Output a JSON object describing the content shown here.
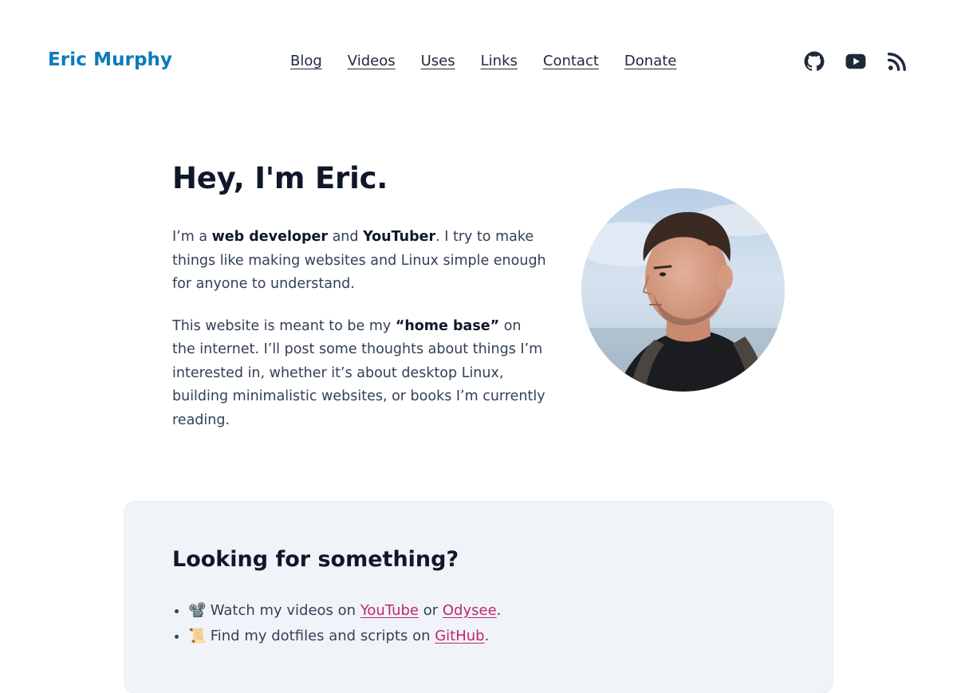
{
  "header": {
    "brand": "Eric Murphy",
    "nav": [
      {
        "label": "Blog"
      },
      {
        "label": "Videos"
      },
      {
        "label": "Uses"
      },
      {
        "label": "Links"
      },
      {
        "label": "Contact"
      },
      {
        "label": "Donate"
      }
    ],
    "social": [
      {
        "icon": "github-icon"
      },
      {
        "icon": "youtube-icon"
      },
      {
        "icon": "rss-icon"
      }
    ]
  },
  "hero": {
    "title": "Hey, I'm Eric.",
    "p1": {
      "t1": "I’m a ",
      "b1": "web developer",
      "t2": " and ",
      "b2": "YouTuber",
      "t3": ". I try to make things like making websites and Linux simple enough for anyone to understand."
    },
    "p2": {
      "t1": "This website is meant to be my ",
      "b1": "“home base”",
      "t2": " on the internet. I’ll post some thoughts about things I’m interested in, whether it’s about desktop Linux, building minimalistic websites, or books I’m currently reading."
    },
    "avatar_icon": "portrait-photo"
  },
  "card": {
    "title": "Looking for something?",
    "items": [
      {
        "emoji": "📽️",
        "text1": " Watch my videos on ",
        "link1": "YouTube",
        "text2": " or ",
        "link2": "Odysee",
        "text3": "."
      },
      {
        "emoji": "📜",
        "text1": " Find my dotfiles and scripts on ",
        "link1": "GitHub",
        "text2": "."
      }
    ]
  },
  "colors": {
    "brand": "#0b7bb8",
    "link": "#c0266f",
    "card_bg": "#f0f4f8"
  }
}
